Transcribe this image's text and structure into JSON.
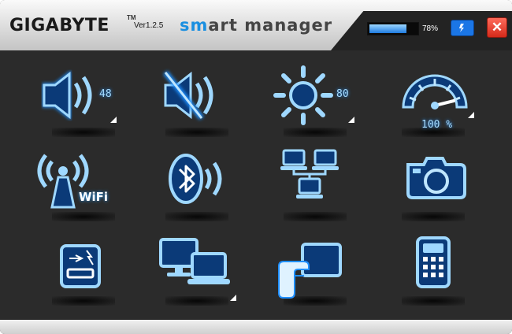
{
  "window": {
    "brand": "GIGABYTE",
    "trademark": "TM",
    "version": "Ver1.2.5",
    "app_name_accent": "sm",
    "app_name_rest": "art manager",
    "battery_percent": 78,
    "battery_label": "78%",
    "power_button_icon": "power-plug-icon",
    "close_button_label": "✕"
  },
  "tiles": [
    {
      "name": "volume",
      "icon": "speaker-icon",
      "level": "48",
      "has_menu": true
    },
    {
      "name": "mute",
      "icon": "speaker-mute-icon",
      "has_menu": false
    },
    {
      "name": "brightness",
      "icon": "sun-icon",
      "level": "80",
      "has_menu": true
    },
    {
      "name": "performance",
      "icon": "speedometer-icon",
      "level": "100 %",
      "has_menu": true
    },
    {
      "name": "wifi",
      "icon": "wifi-antenna-icon",
      "label": "WiFi",
      "has_menu": false
    },
    {
      "name": "bluetooth",
      "icon": "bluetooth-icon",
      "has_menu": false
    },
    {
      "name": "network",
      "icon": "network-computers-icon",
      "has_menu": false
    },
    {
      "name": "camera",
      "icon": "camera-icon",
      "has_menu": false
    },
    {
      "name": "usb",
      "icon": "usb-charge-icon",
      "has_menu": false
    },
    {
      "name": "display",
      "icon": "dual-display-icon",
      "has_menu": true
    },
    {
      "name": "touchpad",
      "icon": "touchpad-hand-icon",
      "has_menu": false
    },
    {
      "name": "calculator",
      "icon": "calculator-icon",
      "has_menu": false
    }
  ],
  "colors": {
    "glow": "#1f8fff",
    "icon_fill": "#7fc9ff",
    "icon_dark": "#0b3a78",
    "background": "#2b2b2b"
  }
}
